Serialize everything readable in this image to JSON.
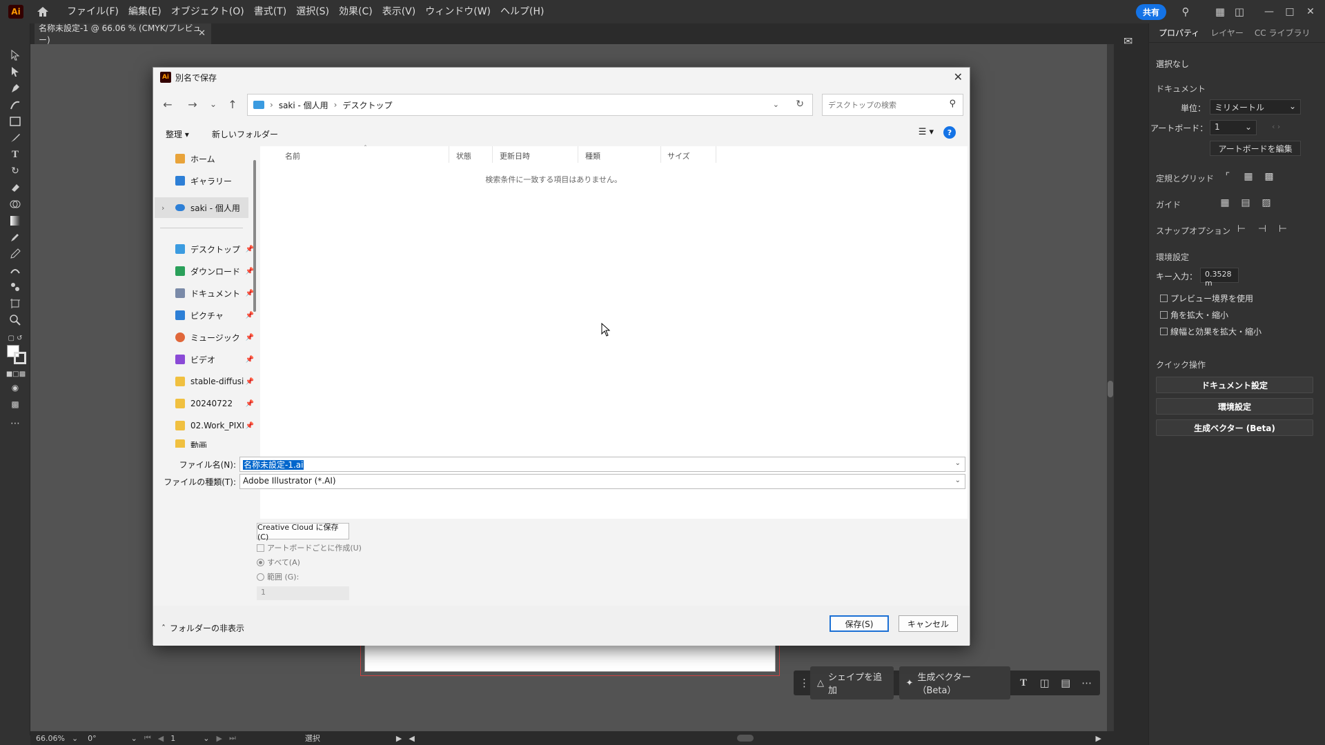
{
  "menubar": {
    "logo": "Ai",
    "items": [
      "ファイル(F)",
      "編集(E)",
      "オブジェクト(O)",
      "書式(T)",
      "選択(S)",
      "効果(C)",
      "表示(V)",
      "ウィンドウ(W)",
      "ヘルプ(H)"
    ],
    "share": "共有"
  },
  "document_tab": {
    "title": "名称未設定-1 @ 66.06 % (CMYK/プレビュー)"
  },
  "dialog": {
    "title": "別名で保存",
    "breadcrumb": [
      "saki - 個人用",
      "デスクトップ"
    ],
    "search_placeholder": "デスクトップの検索",
    "organize": "整理",
    "new_folder": "新しいフォルダー",
    "nav": [
      {
        "label": "ホーム",
        "color": "#e8a33a"
      },
      {
        "label": "ギャラリー",
        "color": "#2d7fd6"
      },
      {
        "label": "saki - 個人用",
        "color": "#2d7fd6"
      },
      {
        "label": "デスクトップ",
        "color": "#3b9be0"
      },
      {
        "label": "ダウンロード",
        "color": "#2aa05a"
      },
      {
        "label": "ドキュメント",
        "color": "#7a8aa8"
      },
      {
        "label": "ピクチャ",
        "color": "#2d7fd6"
      },
      {
        "label": "ミュージック",
        "color": "#e0673a"
      },
      {
        "label": "ビデオ",
        "color": "#8a4ad6"
      },
      {
        "label": "stable-diffusi",
        "color": "#f0c040"
      },
      {
        "label": "20240722",
        "color": "#f0c040"
      },
      {
        "label": "02.Work_PIXI",
        "color": "#f0c040"
      },
      {
        "label": "動画",
        "color": "#f0c040"
      }
    ],
    "columns": [
      "名前",
      "状態",
      "更新日時",
      "種類",
      "サイズ"
    ],
    "empty_message": "検索条件に一致する項目はありません。",
    "filename_label": "ファイル名(N):",
    "filename_value": "名称未設定-1.ai",
    "filetype_label": "ファイルの種類(T):",
    "filetype_value": "Adobe Illustrator (*.AI)",
    "cc_save": "Creative Cloud に保存(C)",
    "per_artboard": "アートボードごとに作成(U)",
    "all": "すべて(A)",
    "range": "範囲 (G):",
    "range_value": "1",
    "hide_folders": "フォルダーの非表示",
    "save": "保存(S)",
    "cancel": "キャンセル"
  },
  "right_panel": {
    "tabs": [
      "プロパティ",
      "レイヤー",
      "CC ライブラリ"
    ],
    "no_selection": "選択なし",
    "document": "ドキュメント",
    "units_label": "単位：",
    "units_value": "ミリメートル",
    "artboard_label": "アートボード：",
    "artboard_value": "1",
    "edit_artboard": "アートボードを編集",
    "rulers_grid": "定規とグリッド",
    "guides": "ガイド",
    "snap_options": "スナップオプション",
    "preferences": "環境設定",
    "key_input_label": "キー入力：",
    "key_input_value": "0.3528 m",
    "check_preview": "プレビュー境界を使用",
    "check_corners": "角を拡大・縮小",
    "check_strokes": "線幅と効果を拡大・縮小",
    "quick_actions": "クイック操作",
    "btn_doc_setup": "ドキュメント設定",
    "btn_prefs": "環境設定",
    "btn_gen_vector": "生成ベクター (Beta)"
  },
  "context_bar": {
    "add_shape": "シェイプを追加",
    "gen_vector": "生成ベクター（Beta）"
  },
  "statusbar": {
    "zoom": "66.06%",
    "rotation": "0°",
    "artboard": "1",
    "mode": "選択"
  }
}
